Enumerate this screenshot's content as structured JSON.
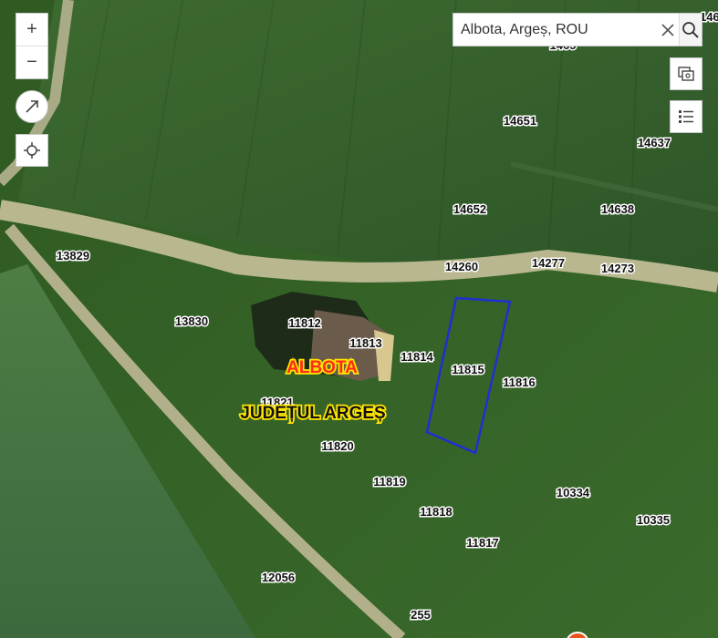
{
  "search": {
    "value": "Albota, Argeș, ROU"
  },
  "controls": {
    "zoom_in": "+",
    "zoom_out": "−"
  },
  "map": {
    "place_label": "ALBOTA",
    "county_label": "JUDEȚUL ARGEȘ",
    "parcels": [
      "14651",
      "14637",
      "14652",
      "14638",
      "13829",
      "14260",
      "14277",
      "14273",
      "13830",
      "11812",
      "11813",
      "11814",
      "11815",
      "11816",
      "11821",
      "11820",
      "11819",
      "11818",
      "11817",
      "10334",
      "10335",
      "12056",
      "255",
      "1465",
      "146"
    ]
  },
  "colors": {
    "field_dark": "#335a2a",
    "field_light": "#4a7a3a",
    "road": "#b8b78f",
    "parcel_outline": "#1f2fd0",
    "place_label_fill": "#ff2a1a",
    "place_label_stroke": "#ffe600"
  }
}
